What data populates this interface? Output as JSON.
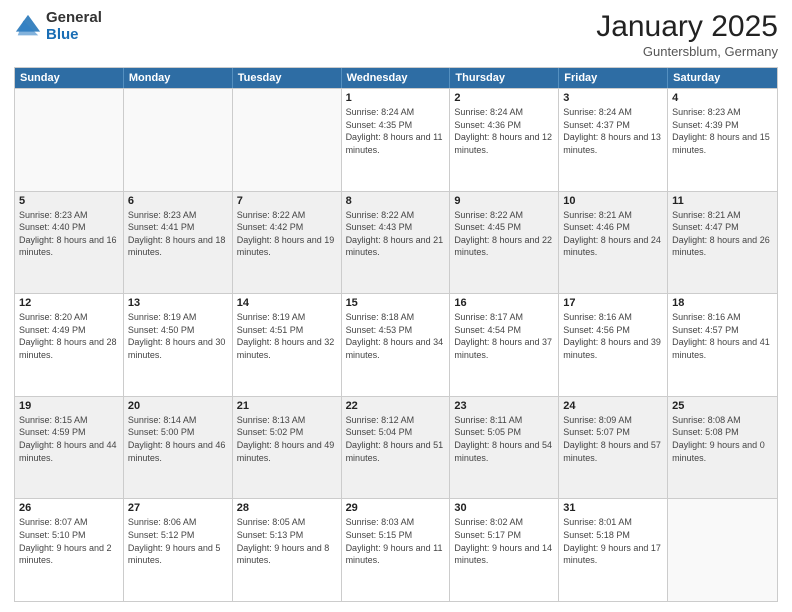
{
  "header": {
    "logo_general": "General",
    "logo_blue": "Blue",
    "main_title": "January 2025",
    "subtitle": "Guntersblum, Germany"
  },
  "calendar": {
    "days_of_week": [
      "Sunday",
      "Monday",
      "Tuesday",
      "Wednesday",
      "Thursday",
      "Friday",
      "Saturday"
    ],
    "weeks": [
      [
        {
          "day": "",
          "empty": true
        },
        {
          "day": "",
          "empty": true
        },
        {
          "day": "",
          "empty": true
        },
        {
          "day": "1",
          "sunrise": "8:24 AM",
          "sunset": "4:35 PM",
          "daylight": "8 hours and 11 minutes."
        },
        {
          "day": "2",
          "sunrise": "8:24 AM",
          "sunset": "4:36 PM",
          "daylight": "8 hours and 12 minutes."
        },
        {
          "day": "3",
          "sunrise": "8:24 AM",
          "sunset": "4:37 PM",
          "daylight": "8 hours and 13 minutes."
        },
        {
          "day": "4",
          "sunrise": "8:23 AM",
          "sunset": "4:39 PM",
          "daylight": "8 hours and 15 minutes."
        }
      ],
      [
        {
          "day": "5",
          "sunrise": "8:23 AM",
          "sunset": "4:40 PM",
          "daylight": "8 hours and 16 minutes."
        },
        {
          "day": "6",
          "sunrise": "8:23 AM",
          "sunset": "4:41 PM",
          "daylight": "8 hours and 18 minutes."
        },
        {
          "day": "7",
          "sunrise": "8:22 AM",
          "sunset": "4:42 PM",
          "daylight": "8 hours and 19 minutes."
        },
        {
          "day": "8",
          "sunrise": "8:22 AM",
          "sunset": "4:43 PM",
          "daylight": "8 hours and 21 minutes."
        },
        {
          "day": "9",
          "sunrise": "8:22 AM",
          "sunset": "4:45 PM",
          "daylight": "8 hours and 22 minutes."
        },
        {
          "day": "10",
          "sunrise": "8:21 AM",
          "sunset": "4:46 PM",
          "daylight": "8 hours and 24 minutes."
        },
        {
          "day": "11",
          "sunrise": "8:21 AM",
          "sunset": "4:47 PM",
          "daylight": "8 hours and 26 minutes."
        }
      ],
      [
        {
          "day": "12",
          "sunrise": "8:20 AM",
          "sunset": "4:49 PM",
          "daylight": "8 hours and 28 minutes."
        },
        {
          "day": "13",
          "sunrise": "8:19 AM",
          "sunset": "4:50 PM",
          "daylight": "8 hours and 30 minutes."
        },
        {
          "day": "14",
          "sunrise": "8:19 AM",
          "sunset": "4:51 PM",
          "daylight": "8 hours and 32 minutes."
        },
        {
          "day": "15",
          "sunrise": "8:18 AM",
          "sunset": "4:53 PM",
          "daylight": "8 hours and 34 minutes."
        },
        {
          "day": "16",
          "sunrise": "8:17 AM",
          "sunset": "4:54 PM",
          "daylight": "8 hours and 37 minutes."
        },
        {
          "day": "17",
          "sunrise": "8:16 AM",
          "sunset": "4:56 PM",
          "daylight": "8 hours and 39 minutes."
        },
        {
          "day": "18",
          "sunrise": "8:16 AM",
          "sunset": "4:57 PM",
          "daylight": "8 hours and 41 minutes."
        }
      ],
      [
        {
          "day": "19",
          "sunrise": "8:15 AM",
          "sunset": "4:59 PM",
          "daylight": "8 hours and 44 minutes."
        },
        {
          "day": "20",
          "sunrise": "8:14 AM",
          "sunset": "5:00 PM",
          "daylight": "8 hours and 46 minutes."
        },
        {
          "day": "21",
          "sunrise": "8:13 AM",
          "sunset": "5:02 PM",
          "daylight": "8 hours and 49 minutes."
        },
        {
          "day": "22",
          "sunrise": "8:12 AM",
          "sunset": "5:04 PM",
          "daylight": "8 hours and 51 minutes."
        },
        {
          "day": "23",
          "sunrise": "8:11 AM",
          "sunset": "5:05 PM",
          "daylight": "8 hours and 54 minutes."
        },
        {
          "day": "24",
          "sunrise": "8:09 AM",
          "sunset": "5:07 PM",
          "daylight": "8 hours and 57 minutes."
        },
        {
          "day": "25",
          "sunrise": "8:08 AM",
          "sunset": "5:08 PM",
          "daylight": "9 hours and 0 minutes."
        }
      ],
      [
        {
          "day": "26",
          "sunrise": "8:07 AM",
          "sunset": "5:10 PM",
          "daylight": "9 hours and 2 minutes."
        },
        {
          "day": "27",
          "sunrise": "8:06 AM",
          "sunset": "5:12 PM",
          "daylight": "9 hours and 5 minutes."
        },
        {
          "day": "28",
          "sunrise": "8:05 AM",
          "sunset": "5:13 PM",
          "daylight": "9 hours and 8 minutes."
        },
        {
          "day": "29",
          "sunrise": "8:03 AM",
          "sunset": "5:15 PM",
          "daylight": "9 hours and 11 minutes."
        },
        {
          "day": "30",
          "sunrise": "8:02 AM",
          "sunset": "5:17 PM",
          "daylight": "9 hours and 14 minutes."
        },
        {
          "day": "31",
          "sunrise": "8:01 AM",
          "sunset": "5:18 PM",
          "daylight": "9 hours and 17 minutes."
        },
        {
          "day": "",
          "empty": true
        }
      ]
    ]
  }
}
